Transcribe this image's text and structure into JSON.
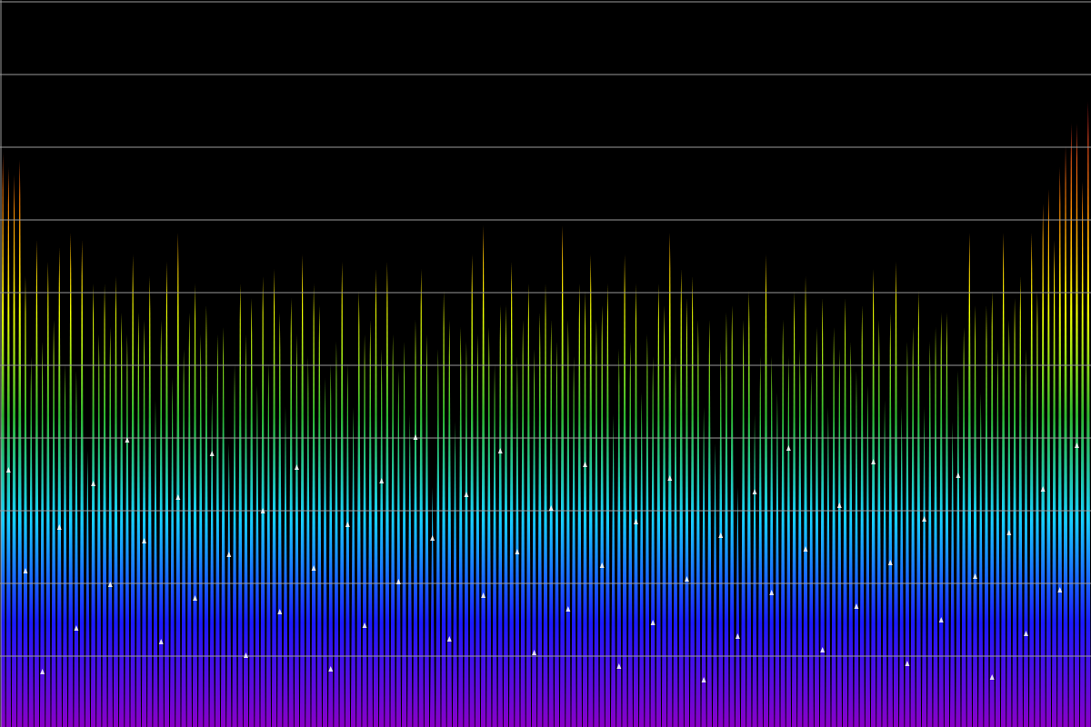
{
  "chart_data": {
    "type": "area",
    "title": "",
    "xlabel": "",
    "ylabel": "",
    "grid": true,
    "ylim": [
      0,
      10
    ],
    "gridlines": [
      1,
      2,
      3,
      4,
      5,
      6,
      7,
      8,
      9,
      10
    ],
    "color_scale": [
      "#8a00c8",
      "#1a1aff",
      "#18d2ff",
      "#2fb82f",
      "#f0ff00",
      "#ff8a00",
      "#e6262c",
      "#b8004a"
    ],
    "background": "#000000",
    "grid_color": "#9a9a9a",
    "peak_marker_color": "#ffffff",
    "series": [
      {
        "values": [
          7.9,
          7.7,
          7.6,
          7.8,
          6.2,
          5.1,
          6.7,
          5.3,
          6.4,
          5.6,
          6.6,
          5.0,
          6.8,
          4.9,
          6.7,
          3.8,
          6.1,
          5.4,
          6.1,
          5.5,
          6.2,
          5.7,
          5.4,
          6.5,
          5.7,
          5.6,
          6.2,
          4.5,
          5.6,
          6.4,
          4.8,
          6.8,
          5.2,
          5.7,
          6.1,
          5.4,
          5.8,
          4.6,
          5.4,
          5.5,
          3.9,
          5.0,
          6.1,
          5.4,
          5.9,
          4.7,
          6.2,
          5.0,
          6.3,
          5.7,
          4.4,
          5.9,
          5.4,
          6.5,
          5.1,
          6.1,
          5.8,
          4.8,
          5.0,
          5.3,
          6.4,
          5.0,
          4.4,
          6.0,
          5.4,
          5.6,
          6.3,
          5.2,
          6.4,
          5.4,
          4.9,
          5.3,
          4.3,
          5.6,
          6.3,
          5.4,
          3.3,
          5.2,
          6.0,
          5.6,
          4.2,
          5.5,
          5.3,
          6.5,
          5.4,
          6.9,
          5.5,
          5.0,
          5.8,
          5.8,
          6.4,
          5.1,
          5.6,
          6.1,
          5.2,
          5.7,
          6.1,
          5.6,
          5.3,
          6.9,
          5.6,
          5.1,
          6.1,
          6.0,
          6.5,
          5.6,
          5.8,
          6.1,
          4.3,
          5.2,
          6.5,
          5.3,
          6.1,
          4.6,
          5.4,
          5.1,
          6.1,
          5.8,
          6.8,
          5.1,
          6.3,
          5.9,
          6.2,
          5.6,
          4.4,
          5.6,
          3.9,
          5.2,
          5.7,
          5.8,
          3.3,
          5.6,
          6.0,
          4.3,
          5.1,
          6.5,
          5.1,
          4.6,
          5.6,
          5.1,
          6.0,
          5.2,
          6.2,
          4.9,
          5.5,
          5.9,
          4.4,
          5.5,
          5.2,
          5.9,
          5.3,
          4.9,
          5.8,
          4.7,
          6.3,
          5.6,
          4.5,
          5.7,
          6.4,
          4.4,
          5.3,
          5.5,
          6.0,
          4.4,
          5.3,
          5.5,
          5.7,
          5.7,
          4.2,
          4.9,
          5.5,
          6.8,
          5.8,
          4.6,
          5.8,
          6.0,
          5.2,
          6.8,
          5.6,
          5.9,
          6.2,
          5.2,
          6.8,
          6.0,
          7.2,
          7.4,
          6.7,
          7.7,
          8.0,
          8.3,
          8.3,
          7.5,
          8.6
        ]
      }
    ]
  }
}
